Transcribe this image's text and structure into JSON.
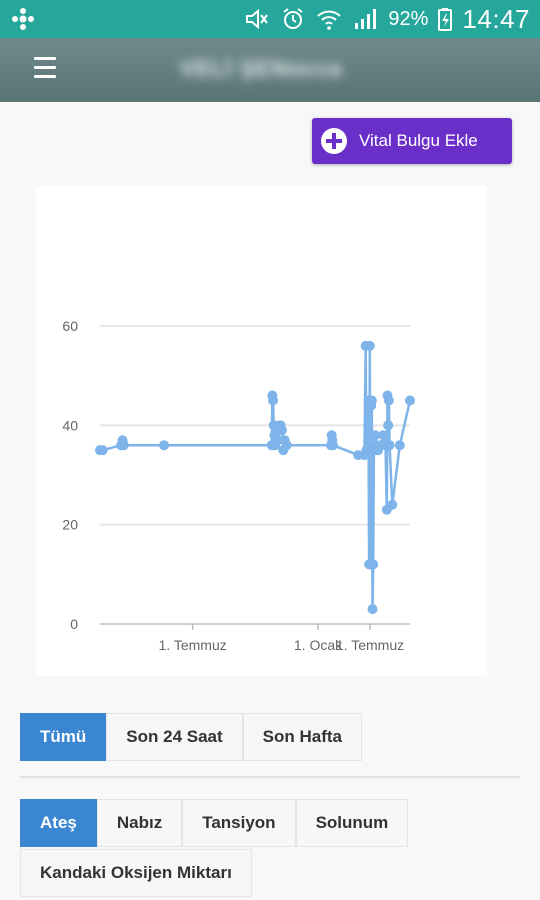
{
  "status_bar": {
    "battery_text": "92%",
    "time": "14:47",
    "color": "#26a79b"
  },
  "header": {
    "title": "VELİ ŞENocca"
  },
  "actions": {
    "add_vital_label": "Vital Bulgu Ekle",
    "add_vital_color": "#6a2fc9"
  },
  "chart_data": {
    "type": "line",
    "x_ticks": [
      "1. Temmuz",
      "1. Ocak",
      "1. Temmuz"
    ],
    "y_ticks": [
      0,
      20,
      40,
      60
    ],
    "ylim": [
      0,
      60
    ],
    "grid": true,
    "legend_position": "bottom",
    "series": [
      {
        "name": "Ateş",
        "color": "#7eb4ea",
        "points": [
          [
            "2016-02-16",
            35
          ],
          [
            "2016-02-20",
            35
          ],
          [
            "2016-03-18",
            36
          ],
          [
            "2016-03-20",
            37
          ],
          [
            "2016-03-22",
            36
          ],
          [
            "2016-05-20",
            36
          ],
          [
            "2016-10-25",
            36
          ],
          [
            "2016-10-26",
            46
          ],
          [
            "2016-10-27",
            45
          ],
          [
            "2016-10-28",
            40
          ],
          [
            "2016-10-29",
            38
          ],
          [
            "2016-10-30",
            36
          ],
          [
            "2016-11-01",
            39
          ],
          [
            "2016-11-03",
            37
          ],
          [
            "2016-11-05",
            40
          ],
          [
            "2016-11-07",
            40
          ],
          [
            "2016-11-09",
            39
          ],
          [
            "2016-11-11",
            35
          ],
          [
            "2016-11-13",
            37
          ],
          [
            "2016-11-16",
            36
          ],
          [
            "2017-01-20",
            36
          ],
          [
            "2017-01-21",
            38
          ],
          [
            "2017-01-22",
            37
          ],
          [
            "2017-01-23",
            36
          ],
          [
            "2017-03-01",
            34
          ],
          [
            "2017-03-10",
            34
          ],
          [
            "2017-03-12",
            56
          ],
          [
            "2017-03-13",
            35
          ],
          [
            "2017-03-16",
            45
          ],
          [
            "2017-03-17",
            12
          ],
          [
            "2017-03-18",
            56
          ],
          [
            "2017-03-19",
            12
          ],
          [
            "2017-03-20",
            44
          ],
          [
            "2017-03-21",
            45
          ],
          [
            "2017-03-22",
            3
          ],
          [
            "2017-03-23",
            12
          ],
          [
            "2017-03-24",
            35
          ],
          [
            "2017-03-26",
            38
          ],
          [
            "2017-03-28",
            36
          ],
          [
            "2017-03-30",
            35
          ],
          [
            "2017-04-03",
            36
          ],
          [
            "2017-04-07",
            38
          ],
          [
            "2017-04-10",
            36
          ],
          [
            "2017-04-12",
            23
          ],
          [
            "2017-04-13",
            46
          ],
          [
            "2017-04-14",
            40
          ],
          [
            "2017-04-15",
            45
          ],
          [
            "2017-04-16",
            36
          ],
          [
            "2017-04-20",
            24
          ],
          [
            "2017-05-01",
            36
          ],
          [
            "2017-05-16",
            45
          ]
        ]
      }
    ]
  },
  "period_tabs": [
    {
      "label": "Tümü",
      "active": true
    },
    {
      "label": "Son 24 Saat",
      "active": false
    },
    {
      "label": "Son Hafta",
      "active": false
    }
  ],
  "vital_tabs": [
    {
      "label": "Ateş",
      "active": true
    },
    {
      "label": "Nabız",
      "active": false
    },
    {
      "label": "Tansiyon",
      "active": false
    },
    {
      "label": "Solunum",
      "active": false
    },
    {
      "label": "Kandaki Oksijen Miktarı",
      "active": false
    }
  ],
  "accent_color": "#3a86d1"
}
